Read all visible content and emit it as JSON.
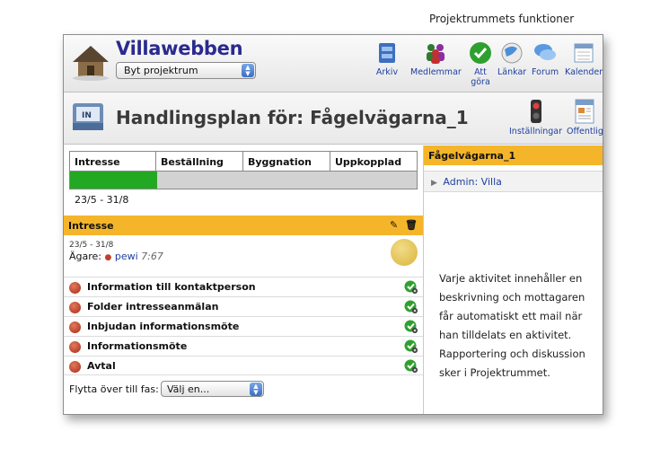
{
  "caption": "Projektrummets funktioner",
  "app": {
    "title": "Villawebben",
    "project_select": "Byt projektrum"
  },
  "toolbar": [
    {
      "label": "Arkiv",
      "icon": "archive-icon"
    },
    {
      "label": "Medlemmar",
      "icon": "members-icon"
    },
    {
      "label": "Att\ngöra",
      "icon": "todo-check-icon"
    },
    {
      "label": "Länkar",
      "icon": "links-globe-icon"
    },
    {
      "label": "Forum",
      "icon": "forum-bubble-icon"
    },
    {
      "label": "Kalender",
      "icon": "calendar-icon"
    }
  ],
  "plan": {
    "title": "Handlingsplan för: Fågelvägarna_1",
    "settings_label": "Inställningar",
    "public_label": "Offentlig"
  },
  "phases": {
    "headers": [
      "Intresse",
      "Beställning",
      "Byggnation",
      "Uppkopplad"
    ],
    "progress_done_fraction": 0.25,
    "date_range": "23/5 - 31/8"
  },
  "section": {
    "title": "Intresse",
    "task_date": "23/5 - 31/8",
    "owner_label": "Ägare:",
    "owner_name": "pewi",
    "owner_time": "7:67"
  },
  "activities": [
    "Information till kontaktperson",
    "Folder intresseanmälan",
    "Inbjudan informationsmöte",
    "Informationsmöte",
    "Avtal"
  ],
  "move": {
    "label": "Flytta över till fas:",
    "select": "Välj en..."
  },
  "right_panel": {
    "title": "Fågelvägarna_1",
    "admin": "Admin: Villa"
  },
  "description": "Varje aktivitet innehåller en beskrivning och mottagaren får automatiskt ett mail när han tilldelats en aktivitet. Rapportering och diskussion sker i Projektrummet.",
  "colors": {
    "accent": "#f5b52a",
    "progress": "#22a822",
    "link": "#1d3fa0"
  }
}
